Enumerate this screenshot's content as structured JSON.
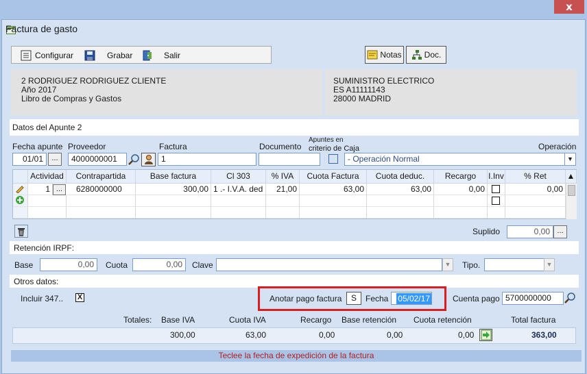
{
  "window": {
    "title": "Factura de gasto",
    "close_glyph": "x"
  },
  "toolbar": {
    "configurar": "Configurar",
    "grabar": "Grabar",
    "salir": "Salir",
    "notas": "Notas",
    "doc": "Doc."
  },
  "client": {
    "line1": "2 RODRIGUEZ RODRIGUEZ CLIENTE",
    "line2": "Año 2017",
    "line3": "Libro de Compras y Gastos"
  },
  "supplier": {
    "line1": "SUMINISTRO ELECTRICO",
    "line2": "ES A11111143",
    "line3": "28000 MADRID"
  },
  "apunte": {
    "section_title": "Datos del Apunte 2",
    "fecha_label": "Fecha apunte",
    "fecha_value": "01/01",
    "proveedor_label": "Proveedor",
    "proveedor_value": "4000000001",
    "factura_label": "Factura",
    "factura_value": "1",
    "documento_label": "Documento",
    "documento_value": "",
    "caja_label_1": "Apuntes en",
    "caja_label_2": "criterio de Caja",
    "operacion_label": "Operación",
    "operacion_value": "- Operación Normal",
    "dots": "..."
  },
  "grid": {
    "headers": [
      "Actividad",
      "Contrapartida",
      "Base factura",
      "Cl 303",
      "% IVA",
      "Cuota Factura",
      "Cuota deduc.",
      "Recargo",
      "I.Inv",
      "% Ret"
    ],
    "row": {
      "actividad": "1",
      "contrapartida": "6280000000",
      "base": "300,00",
      "cl303": "1 .- I.V.A. ded",
      "iva": "21,00",
      "cuota_factura": "63,00",
      "cuota_deduc": "63,00",
      "recargo": "0,00",
      "ret": "0,00"
    }
  },
  "suplido": {
    "label": "Suplido",
    "value": "0,00"
  },
  "irpf": {
    "title": "Retención IRPF:",
    "base_label": "Base",
    "base_value": "0,00",
    "cuota_label": "Cuota",
    "cuota_value": "0,00",
    "clave_label": "Clave",
    "clave_value": "",
    "tipo_label": "Tipo.",
    "tipo_value": ""
  },
  "otros": {
    "title": "Otros datos:",
    "incluir_label": "Incluir 347..",
    "incluir_checked": "X",
    "anotar_label": "Anotar pago factura",
    "anotar_value": "S",
    "fecha_label": "Fecha",
    "fecha_value": "05/02/17",
    "cuenta_label": "Cuenta pago",
    "cuenta_value": "5700000000"
  },
  "totales": {
    "label": "Totales:",
    "base_iva_label": "Base IVA",
    "cuota_iva_label": "Cuota IVA",
    "recargo_label": "Recargo",
    "base_ret_label": "Base retención",
    "cuota_ret_label": "Cuota retención",
    "total_label": "Total factura",
    "base_iva": "300,00",
    "cuota_iva": "63,00",
    "recargo": "0,00",
    "base_ret": "0,00",
    "cuota_ret": "0,00",
    "total": "363,00"
  },
  "status": {
    "message": "Teclee la fecha de expedición de la factura"
  },
  "colors": {
    "accent_highlight": "#d71f1f",
    "status_text": "#b51e1e",
    "selected_field": "#3399ff"
  }
}
